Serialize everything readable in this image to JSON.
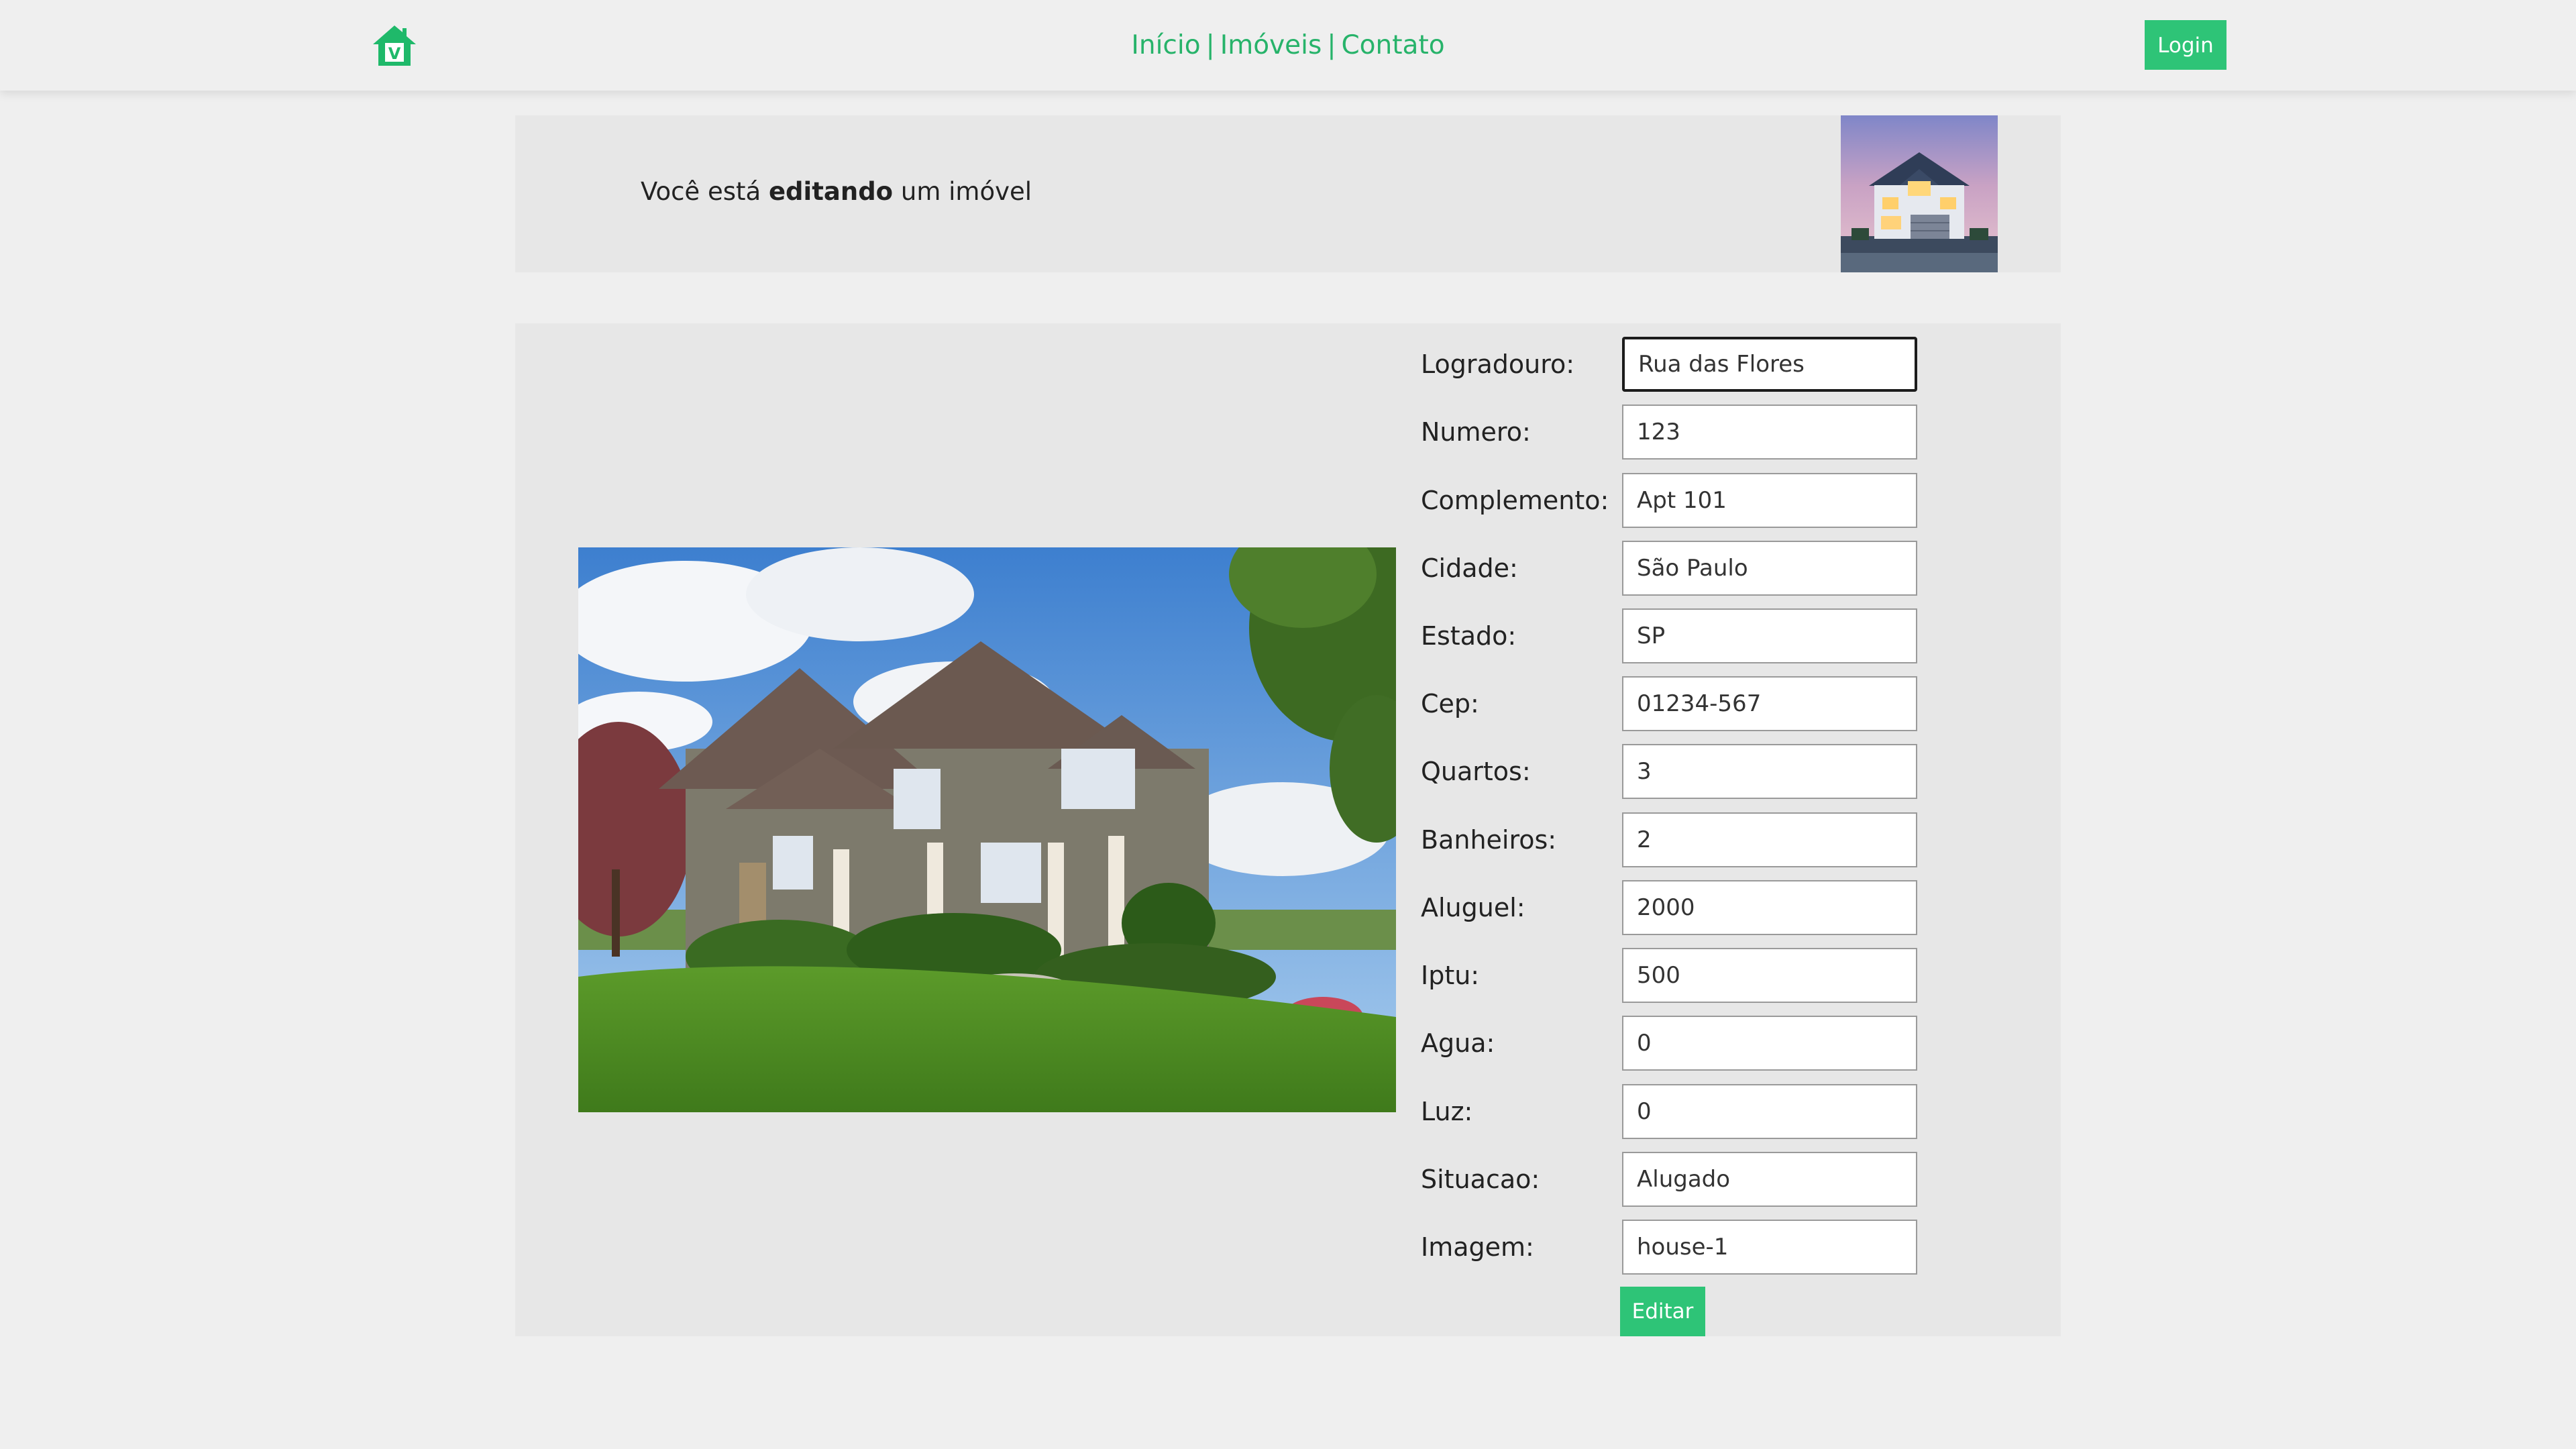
{
  "nav": {
    "links": [
      "Início",
      "Imóveis",
      "Contato"
    ],
    "separator": "|",
    "login_label": "Login",
    "logo_icon": "home-icon",
    "logo_letter": "V"
  },
  "banner": {
    "text_prefix": "Você está",
    "text_bold": "editando",
    "text_suffix": "um imóvel",
    "thumbnail": "house-thumbnail-image"
  },
  "property_photo": "house-photo-image",
  "form": {
    "fields": [
      {
        "label": "Logradouro:",
        "value": "Rua das Flores"
      },
      {
        "label": "Numero:",
        "value": "123"
      },
      {
        "label": "Complemento:",
        "value": "Apt 101"
      },
      {
        "label": "Cidade:",
        "value": "São Paulo"
      },
      {
        "label": "Estado:",
        "value": "SP"
      },
      {
        "label": "Cep:",
        "value": "01234-567"
      },
      {
        "label": "Quartos:",
        "value": "3"
      },
      {
        "label": "Banheiros:",
        "value": "2"
      },
      {
        "label": "Aluguel:",
        "value": "2000"
      },
      {
        "label": "Iptu:",
        "value": "500"
      },
      {
        "label": "Agua:",
        "value": "0"
      },
      {
        "label": "Luz:",
        "value": "0"
      },
      {
        "label": "Situacao:",
        "value": "Alugado"
      },
      {
        "label": "Imagem:",
        "value": "house-1"
      }
    ],
    "submit_label": "Editar"
  },
  "colors": {
    "accent": "#2ec477",
    "link": "#27b36a",
    "page_bg": "#efefef",
    "panel_bg": "#e7e7e7"
  }
}
